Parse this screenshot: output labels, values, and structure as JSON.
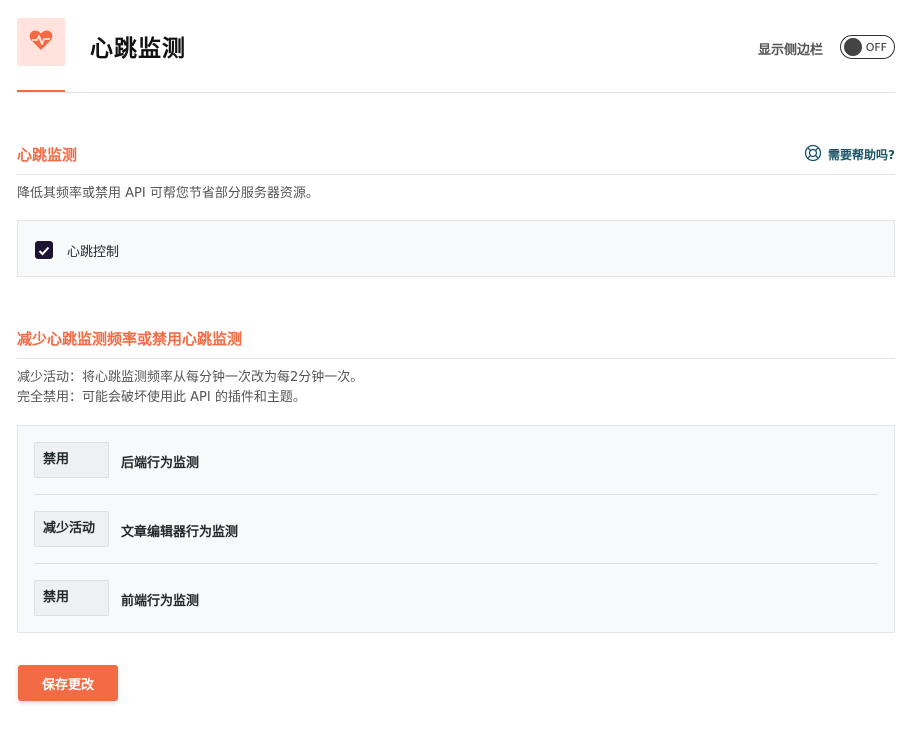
{
  "header": {
    "title": "心跳监测",
    "logo_icon": "heartbeat-icon",
    "sidebar_toggle_label": "显示侧边栏",
    "sidebar_toggle_state": "OFF"
  },
  "section_control": {
    "title": "心跳监测",
    "help_label": "需要帮助吗?",
    "help_icon": "lifebuoy-icon",
    "description": "降低其频率或禁用 API 可帮您节省部分服务器资源。",
    "checkbox_label": "心跳控制",
    "checkbox_checked": true
  },
  "section_frequency": {
    "title": "减少心跳监测频率或禁用心跳监测",
    "description_line1": "减少活动：将心跳监测频率从每分钟一次改为每2分钟一次。",
    "description_line2": "完全禁用：可能会破坏使用此 API 的插件和主题。",
    "rows": [
      {
        "select_value": "禁用",
        "label": "后端行为监测"
      },
      {
        "select_value": "减少活动",
        "label": "文章编辑器行为监测"
      },
      {
        "select_value": "禁用",
        "label": "前端行为监测"
      }
    ]
  },
  "footer": {
    "save_label": "保存更改"
  },
  "colors": {
    "accent": "#f26b45",
    "logo_bg": "#ffe3dc",
    "checkbox": "#1e1233",
    "help_text": "#1a5567"
  }
}
